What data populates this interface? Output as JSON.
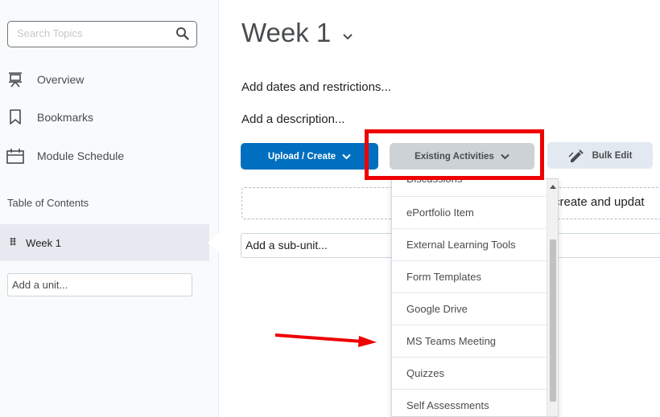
{
  "sidebar": {
    "search_placeholder": "Search Topics",
    "nav": [
      {
        "label": "Overview",
        "icon": "presentation-icon"
      },
      {
        "label": "Bookmarks",
        "icon": "bookmark-icon"
      },
      {
        "label": "Module Schedule",
        "icon": "calendar-icon"
      }
    ],
    "toc_label": "Table of Contents",
    "week_item": "Week 1",
    "add_unit_placeholder": "Add a unit..."
  },
  "main": {
    "title": "Week 1",
    "add_dates": "Add dates and restrictions...",
    "add_description": "Add a description...",
    "buttons": {
      "upload": "Upload / Create",
      "existing": "Existing Activities",
      "bulk_edit": "Bulk Edit"
    },
    "dashed_text": "create and updat",
    "add_subunit": "Add a sub-unit..."
  },
  "dropdown": {
    "items": [
      "Discussions",
      "ePortfolio Item",
      "External Learning Tools",
      "Form Templates",
      "Google Drive",
      "MS Teams Meeting",
      "Quizzes",
      "Self Assessments"
    ]
  },
  "colors": {
    "primary": "#006fbf",
    "annotation": "#ef0000"
  }
}
